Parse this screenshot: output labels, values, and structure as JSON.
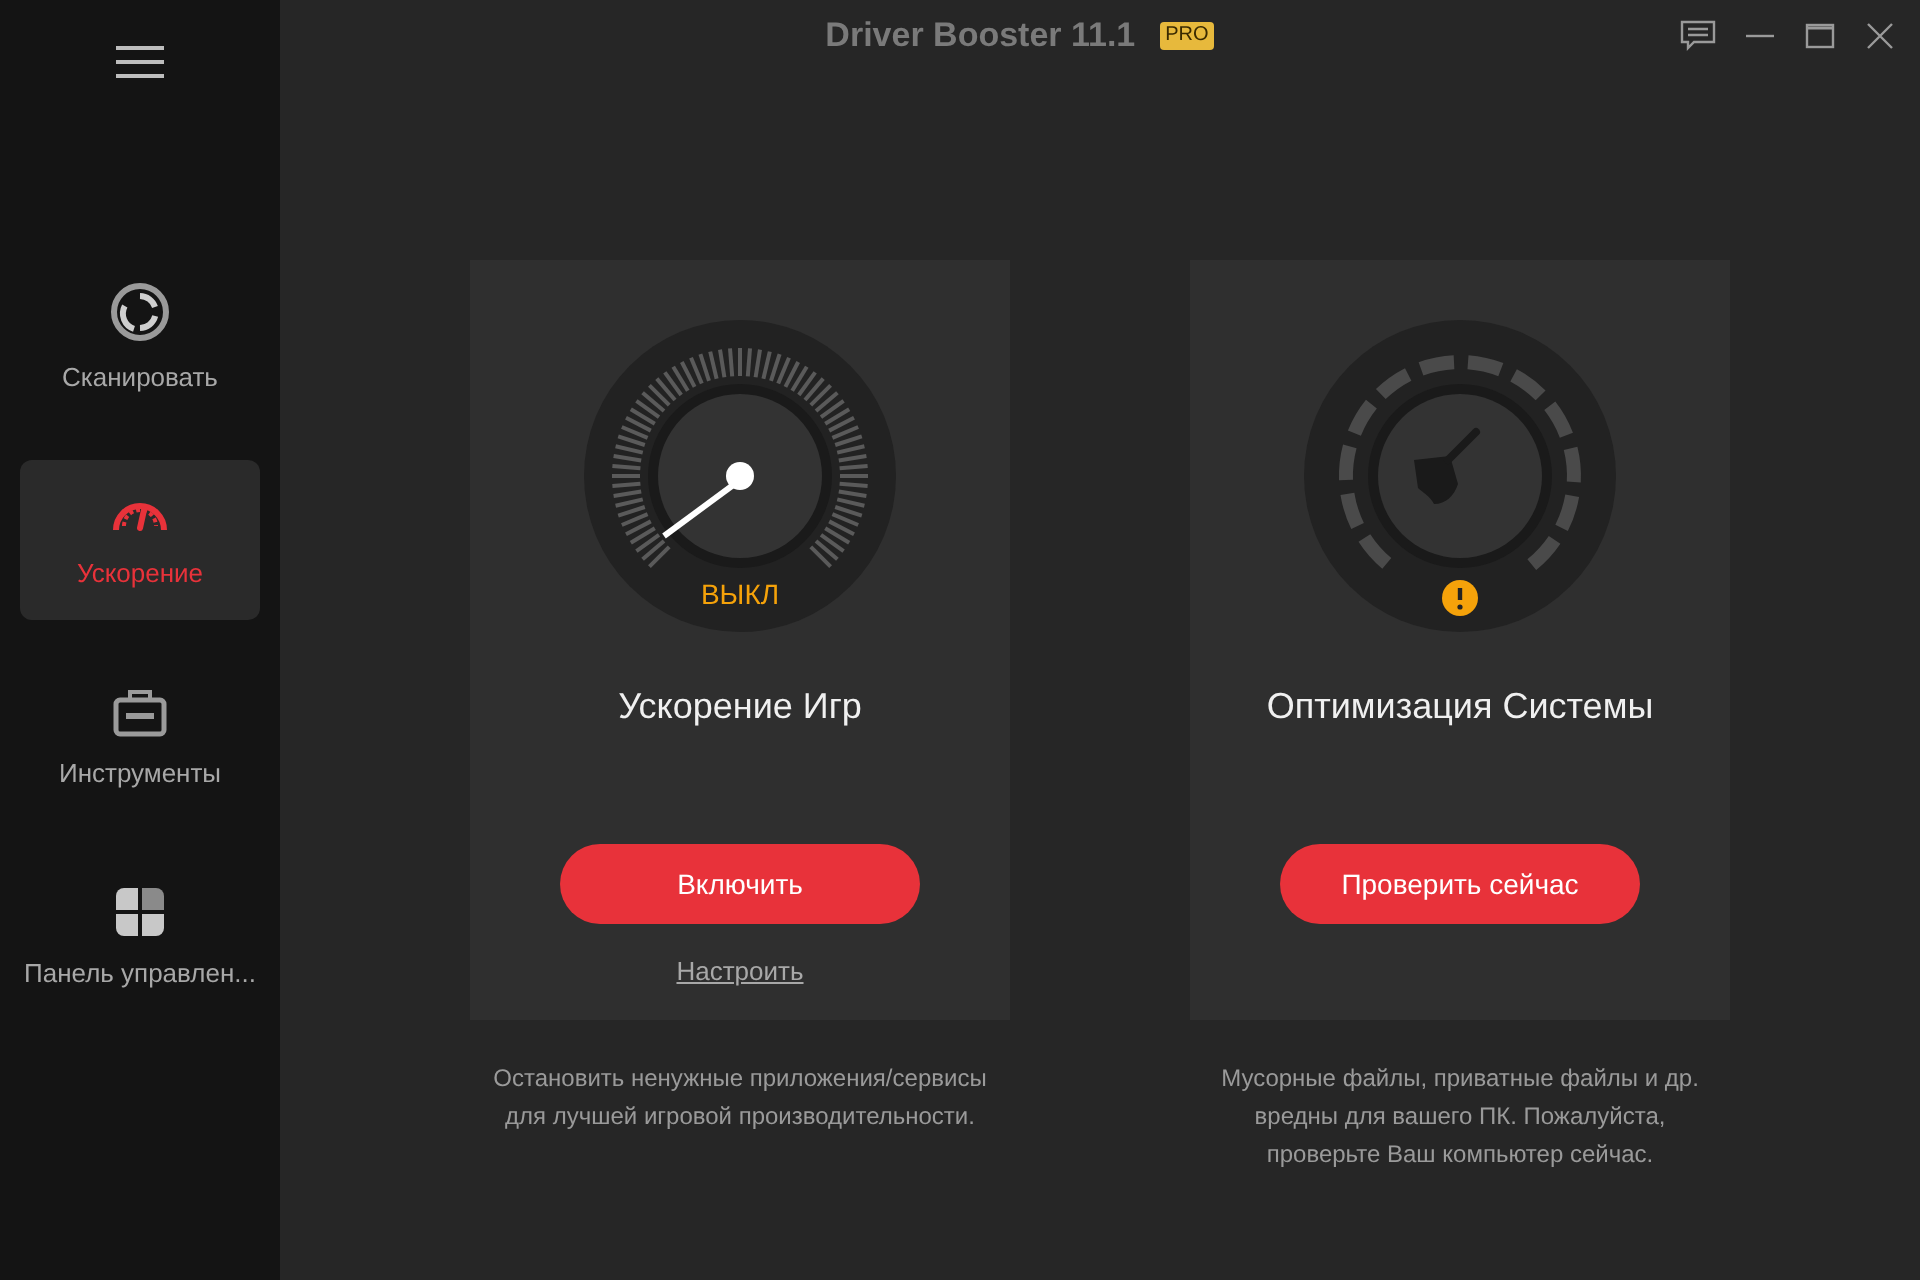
{
  "window": {
    "title": "Driver Booster 11.1",
    "badge": "PRO"
  },
  "sidebar": {
    "items": [
      {
        "label": "Сканировать",
        "kind": "scan",
        "selected": false
      },
      {
        "label": "Ускорение",
        "kind": "boost",
        "selected": true
      },
      {
        "label": "Инструменты",
        "kind": "tools",
        "selected": false
      },
      {
        "label": "Панель управлен...",
        "kind": "panel",
        "selected": false
      }
    ]
  },
  "cards": [
    {
      "kind": "game",
      "title": "Ускорение Игр",
      "gauge_label": "ВЫКЛ",
      "button": "Включить",
      "link": "Настроить",
      "description": "Остановить ненужные приложения/сервисы\nдля лучшей игровой производительности."
    },
    {
      "kind": "system",
      "title": "Оптимизация Системы",
      "warning": true,
      "button": "Проверить сейчас",
      "description": "Мусорные файлы, приватные файлы и др.\nвредны для вашего ПК. Пожалуйста,\nпроверьте Ваш компьютер сейчас."
    }
  ]
}
